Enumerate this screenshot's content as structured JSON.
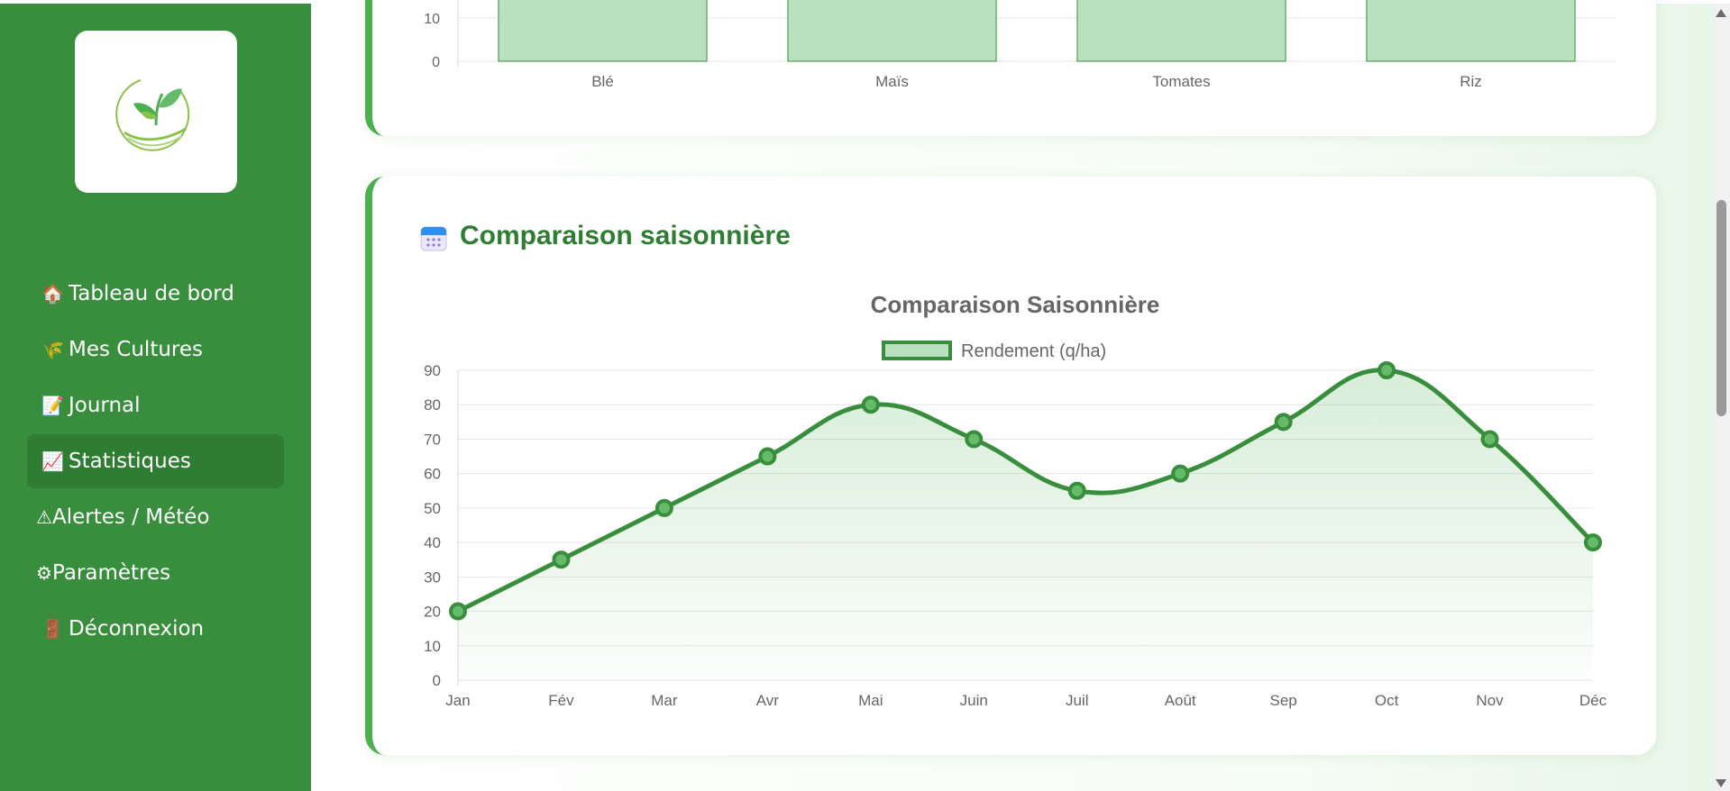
{
  "sidebar": {
    "logo": "sprout-hand-logo",
    "items": [
      {
        "icon": "🏠",
        "label": "Tableau de bord",
        "active": false
      },
      {
        "icon": "🌾",
        "label": "Mes Cultures",
        "active": false
      },
      {
        "icon": "📝",
        "label": "Journal",
        "active": false
      },
      {
        "icon": "📈",
        "label": "Statistiques",
        "active": true
      },
      {
        "icon": "⚠",
        "label": "Alertes / Météo",
        "active": false
      },
      {
        "icon": "⚙",
        "label": "Paramètres",
        "active": false
      },
      {
        "icon": "🚪",
        "label": "Déconnexion",
        "active": false
      }
    ]
  },
  "colors": {
    "sidebar_bg": "#388e3c",
    "sidebar_active": "#2e7d32",
    "accent": "#2e7d32",
    "line": "#388e3c",
    "bar_fill": "#b9e0bf",
    "bar_border": "#388e3c"
  },
  "section": {
    "icon": "calendar-icon",
    "title": "Comparaison saisonnière"
  },
  "chart_data": [
    {
      "type": "bar",
      "partially_visible": true,
      "categories": [
        "Blé",
        "Maïs",
        "Tomates",
        "Riz"
      ],
      "visible_y_ticks": [
        0,
        10
      ]
    },
    {
      "type": "line",
      "title": "Comparaison Saisonnière",
      "categories": [
        "Jan",
        "Fév",
        "Mar",
        "Avr",
        "Mai",
        "Juin",
        "Juil",
        "Août",
        "Sep",
        "Oct",
        "Nov",
        "Déc"
      ],
      "series": [
        {
          "name": "Rendement (q/ha)",
          "values": [
            20,
            35,
            50,
            65,
            80,
            70,
            55,
            60,
            75,
            90,
            70,
            40
          ]
        }
      ],
      "ylim": [
        0,
        90
      ],
      "y_ticks": [
        0,
        10,
        20,
        30,
        40,
        50,
        60,
        70,
        80,
        90
      ],
      "grid": true,
      "legend": "top",
      "fill": true
    }
  ]
}
